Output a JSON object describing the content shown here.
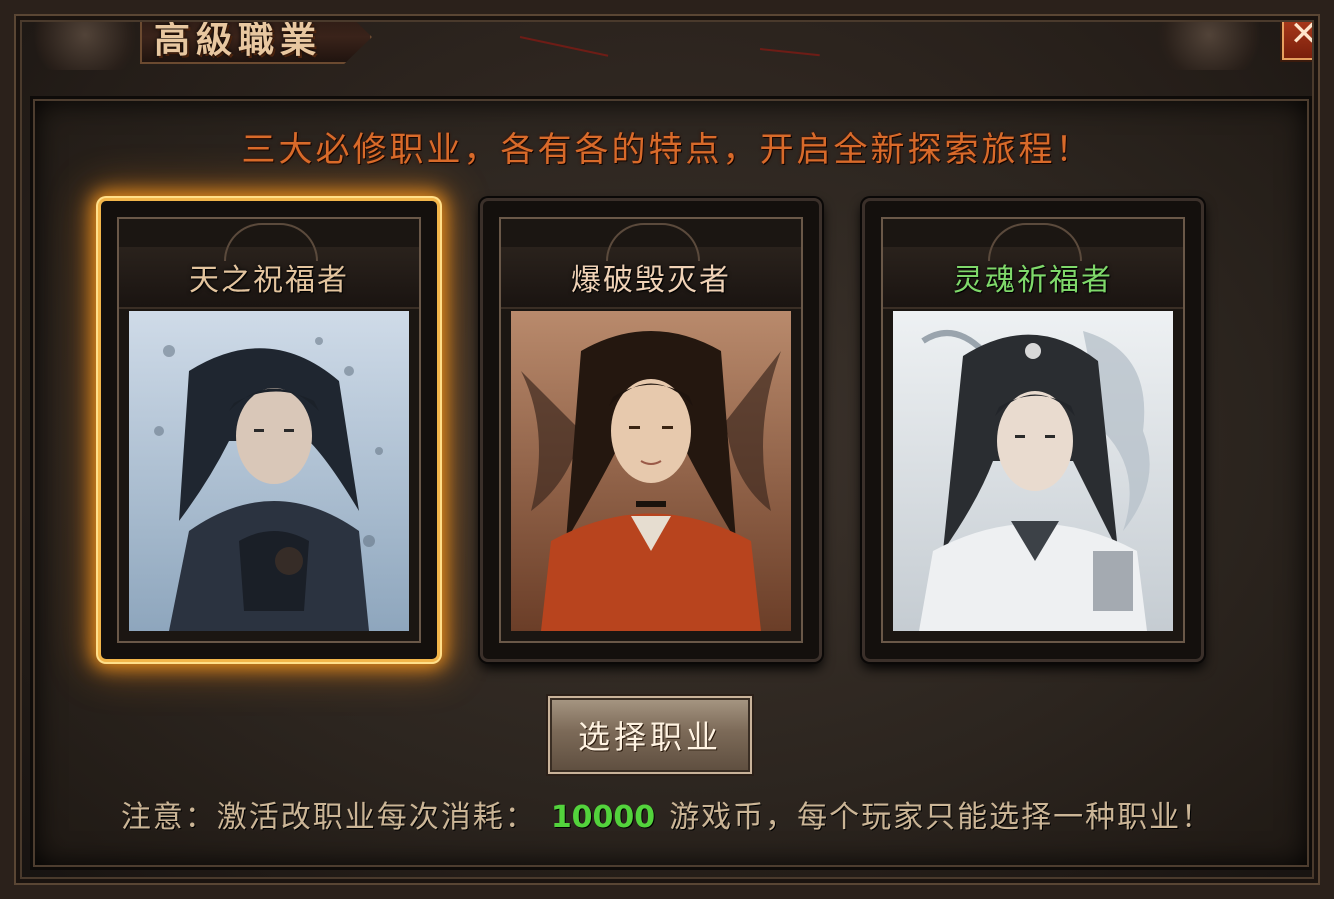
{
  "window": {
    "title": "高級職業",
    "close_label": "✕"
  },
  "subtitle": "三大必修职业，各有各的特点，开启全新探索旅程！",
  "classes": [
    {
      "name": "天之祝福者",
      "name_color": "#e3c49e",
      "selected": true
    },
    {
      "name": "爆破毁灭者",
      "name_color": "#f0d2b6",
      "selected": false
    },
    {
      "name": "灵魂祈福者",
      "name_color": "#7fd86a",
      "selected": false
    }
  ],
  "select_button": "选择职业",
  "notice": {
    "prefix": "注意：激活改职业每次消耗：",
    "amount": "10000",
    "suffix": "游戏币，每个玩家只能选择一种职业！"
  }
}
